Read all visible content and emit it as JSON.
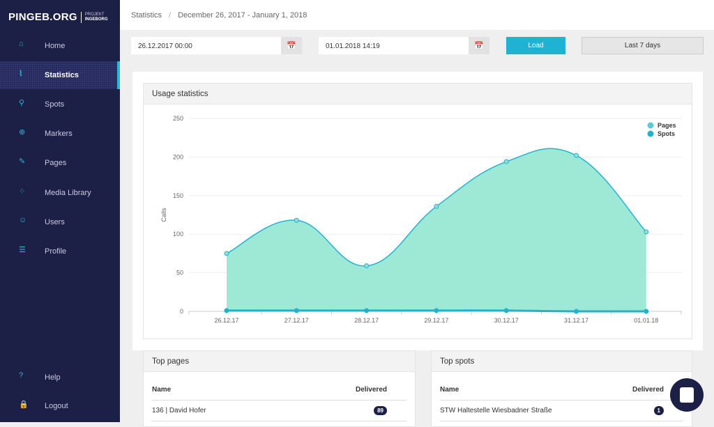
{
  "brand": {
    "name": "PINGEB.ORG",
    "sub1": "PROJEKT",
    "sub2": "INGEBORG"
  },
  "sidebar": {
    "items": [
      {
        "label": "Home",
        "icon": "home-icon"
      },
      {
        "label": "Statistics",
        "icon": "chart-icon",
        "active": true
      },
      {
        "label": "Spots",
        "icon": "map-pin-icon"
      },
      {
        "label": "Markers",
        "icon": "crosshair-icon"
      },
      {
        "label": "Pages",
        "icon": "edit-icon"
      },
      {
        "label": "Media Library",
        "icon": "grid-icon"
      },
      {
        "label": "Users",
        "icon": "user-icon"
      },
      {
        "label": "Profile",
        "icon": "list-icon"
      },
      {
        "label": "Help",
        "icon": "help-icon"
      },
      {
        "label": "Logout",
        "icon": "lock-icon"
      }
    ]
  },
  "header": {
    "breadcrumb": "Statistics",
    "range": "December 26, 2017 - January 1, 2018"
  },
  "filters": {
    "from": "26.12.2017 00:00",
    "to": "01.01.2018 14:19",
    "load": "Load",
    "last7": "Last 7 days"
  },
  "usage": {
    "title": "Usage statistics"
  },
  "colors": {
    "sidebar": "#1c1f46",
    "accent": "#1fb3d3",
    "area": "#9de9d6"
  },
  "chart_data": {
    "type": "area",
    "categories": [
      "26.12.17",
      "27.12.17",
      "28.12.17",
      "29.12.17",
      "30.12.17",
      "31.12.17",
      "01.01.18"
    ],
    "series": [
      {
        "name": "Pages",
        "values": [
          75,
          118,
          59,
          136,
          194,
          202,
          103
        ]
      },
      {
        "name": "Spots",
        "values": [
          1,
          1,
          1,
          1,
          1,
          0,
          0
        ]
      }
    ],
    "ylabel": "Calls",
    "ylim": [
      0,
      250
    ],
    "yticks": [
      0,
      50,
      100,
      150,
      200,
      250
    ],
    "grid": true,
    "legend": "top-right"
  },
  "top_pages": {
    "title": "Top pages",
    "col_name": "Name",
    "col_delivered": "Delivered",
    "rows": [
      {
        "name": "136 | David Hofer",
        "delivered": "89"
      }
    ]
  },
  "top_spots": {
    "title": "Top spots",
    "col_name": "Name",
    "col_delivered": "Delivered",
    "rows": [
      {
        "name": "STW Haltestelle Wiesbadner Straße",
        "delivered": "1"
      }
    ]
  }
}
